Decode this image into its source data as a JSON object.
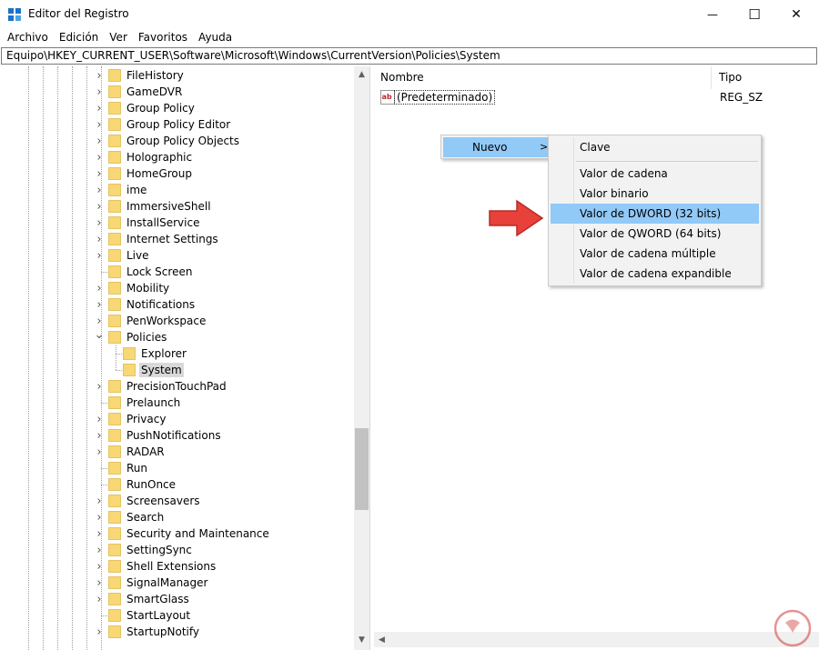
{
  "window": {
    "title": "Editor del Registro",
    "minimize_glyph": "—",
    "maximize_glyph": "☐",
    "close_glyph": "✕"
  },
  "menubar": [
    "Archivo",
    "Edición",
    "Ver",
    "Favoritos",
    "Ayuda"
  ],
  "address": "Equipo\\HKEY_CURRENT_USER\\Software\\Microsoft\\Windows\\CurrentVersion\\Policies\\System",
  "tree": {
    "items": [
      {
        "label": "FileHistory",
        "expander": "collapsed"
      },
      {
        "label": "GameDVR",
        "expander": "collapsed"
      },
      {
        "label": "Group Policy",
        "expander": "collapsed"
      },
      {
        "label": "Group Policy Editor",
        "expander": "collapsed"
      },
      {
        "label": "Group Policy Objects",
        "expander": "collapsed"
      },
      {
        "label": "Holographic",
        "expander": "collapsed"
      },
      {
        "label": "HomeGroup",
        "expander": "collapsed"
      },
      {
        "label": "ime",
        "expander": "collapsed"
      },
      {
        "label": "ImmersiveShell",
        "expander": "collapsed"
      },
      {
        "label": "InstallService",
        "expander": "collapsed"
      },
      {
        "label": "Internet Settings",
        "expander": "collapsed"
      },
      {
        "label": "Live",
        "expander": "collapsed"
      },
      {
        "label": "Lock Screen",
        "expander": "none"
      },
      {
        "label": "Mobility",
        "expander": "collapsed"
      },
      {
        "label": "Notifications",
        "expander": "collapsed"
      },
      {
        "label": "PenWorkspace",
        "expander": "collapsed"
      },
      {
        "label": "Policies",
        "expander": "expanded"
      },
      {
        "label": "Explorer",
        "expander": "child"
      },
      {
        "label": "System",
        "expander": "child-selected"
      },
      {
        "label": "PrecisionTouchPad",
        "expander": "collapsed"
      },
      {
        "label": "Prelaunch",
        "expander": "none"
      },
      {
        "label": "Privacy",
        "expander": "collapsed"
      },
      {
        "label": "PushNotifications",
        "expander": "collapsed"
      },
      {
        "label": "RADAR",
        "expander": "collapsed"
      },
      {
        "label": "Run",
        "expander": "none"
      },
      {
        "label": "RunOnce",
        "expander": "none"
      },
      {
        "label": "Screensavers",
        "expander": "collapsed"
      },
      {
        "label": "Search",
        "expander": "collapsed"
      },
      {
        "label": "Security and Maintenance",
        "expander": "collapsed"
      },
      {
        "label": "SettingSync",
        "expander": "collapsed"
      },
      {
        "label": "Shell Extensions",
        "expander": "collapsed"
      },
      {
        "label": "SignalManager",
        "expander": "collapsed"
      },
      {
        "label": "SmartGlass",
        "expander": "collapsed"
      },
      {
        "label": "StartLayout",
        "expander": "none"
      },
      {
        "label": "StartupNotify",
        "expander": "collapsed"
      }
    ]
  },
  "values_pane": {
    "headers": {
      "name": "Nombre",
      "type": "Tipo"
    },
    "rows": [
      {
        "name": "(Predeterminado)",
        "type": "REG_SZ",
        "icon": "string-value-icon"
      }
    ]
  },
  "context_menu": {
    "item": "Nuevo",
    "submenu": {
      "items": [
        {
          "label": "Clave"
        },
        {
          "label": "Valor de cadena"
        },
        {
          "label": "Valor binario"
        },
        {
          "label": "Valor de DWORD (32 bits)",
          "highlighted": true
        },
        {
          "label": "Valor de QWORD (64 bits)"
        },
        {
          "label": "Valor de cadena múltiple"
        },
        {
          "label": "Valor de cadena expandible"
        }
      ]
    }
  },
  "colors": {
    "menu_highlight": "#91c9f7",
    "arrow_red": "#e8403a",
    "folder_yellow": "#f8d775",
    "selection_gray": "#d9d9d9"
  }
}
